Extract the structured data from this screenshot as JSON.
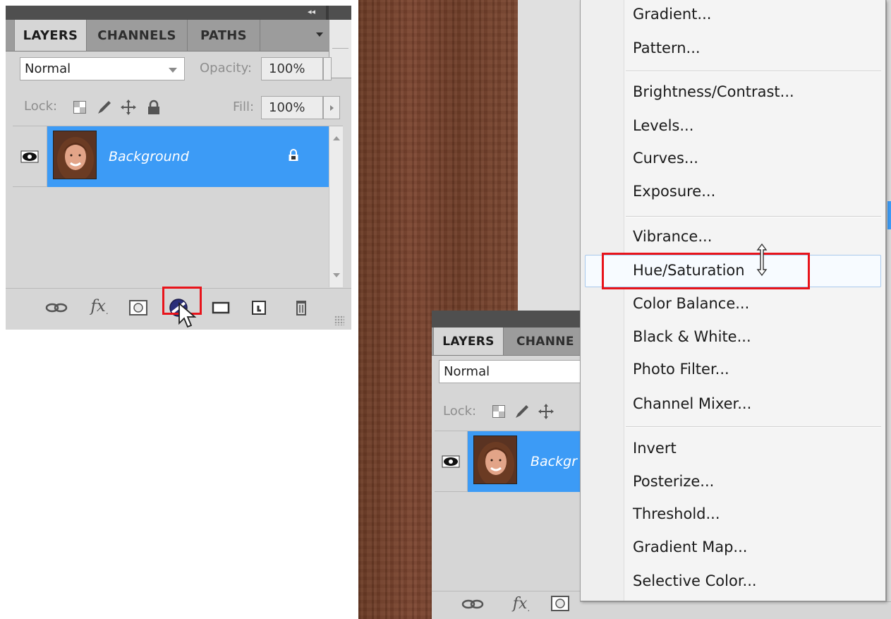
{
  "panel": {
    "tabs": [
      "LAYERS",
      "CHANNELS",
      "PATHS"
    ],
    "blend_mode": "Normal",
    "opacity_label": "Opacity:",
    "opacity_value": "100%",
    "lock_label": "Lock:",
    "fill_label": "Fill:",
    "fill_value": "100%",
    "layer_name": "Background",
    "collapse_glyph": "◂◂"
  },
  "panel2": {
    "tabs": [
      "LAYERS",
      "CHANNE"
    ],
    "blend_mode": "Normal",
    "lock_label": "Lock:",
    "layer_name_partial": "Backgr"
  },
  "footer_icons": [
    "link-layers-icon",
    "fx-icon",
    "layer-mask-icon",
    "adjustment-layer-icon",
    "folder-icon",
    "new-layer-icon",
    "trash-icon"
  ],
  "fx_label": "fx",
  "menu": {
    "groups": [
      [
        "Gradient...",
        "Pattern..."
      ],
      [
        "Brightness/Contrast...",
        "Levels...",
        "Curves...",
        "Exposure..."
      ],
      [
        "Vibrance...",
        "Hue/Saturation...",
        "Color Balance...",
        "Black & White...",
        "Photo Filter...",
        "Channel Mixer..."
      ],
      [
        "Invert",
        "Posterize...",
        "Threshold...",
        "Gradient Map...",
        "Selective Color..."
      ]
    ],
    "highlighted": "Hue/Saturation...",
    "hue_visible_text": "Hue/Saturation"
  },
  "colors": {
    "accent_selection": "#3c9bf6",
    "highlight_box": "#e8141b",
    "panel_bg": "#d6d6d6",
    "wood": "#74412b"
  }
}
